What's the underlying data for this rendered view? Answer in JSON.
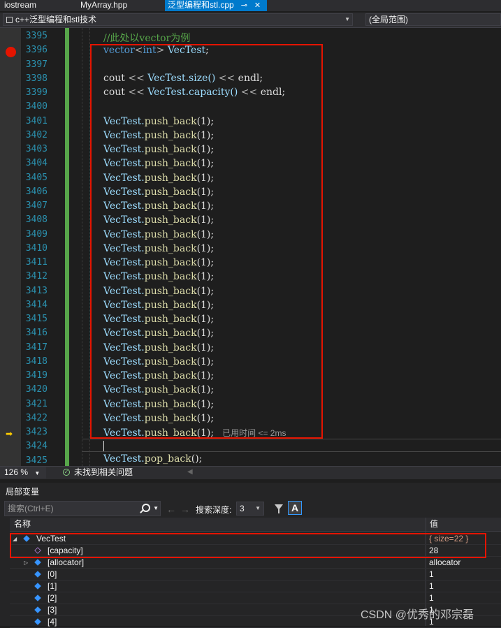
{
  "tabs": [
    {
      "label": "iostream",
      "active": false
    },
    {
      "label": "MyArray.hpp",
      "active": false
    },
    {
      "label": "泛型编程和stl.cpp",
      "active": true
    }
  ],
  "tab_pin_icon": "pin-icon",
  "tab_close_icon": "close-icon",
  "navbar": {
    "project": "c++泛型编程和stl技术",
    "scope": "(全局范围)"
  },
  "editor": {
    "line_numbers": [
      "3395",
      "3396",
      "3397",
      "3398",
      "3399",
      "3400",
      "3401",
      "3402",
      "3403",
      "3404",
      "3405",
      "3406",
      "3407",
      "3408",
      "3409",
      "3410",
      "3411",
      "3412",
      "3413",
      "3414",
      "3415",
      "3416",
      "3417",
      "3418",
      "3419",
      "3420",
      "3421",
      "3422",
      "3423",
      "3424",
      "3425"
    ],
    "comment": "//此处以vector为例",
    "decl_type": "vector",
    "decl_lt": "<",
    "decl_int": "int",
    "decl_gt": ">",
    "decl_var": "VecTest",
    "semicolon": ";",
    "cout": "cout",
    "shift": "<<",
    "size_call": "VecTest.size()",
    "capacity_call": "VecTest.capacity()",
    "endl": "endl",
    "push_back_var": "VecTest.",
    "push_back_fn": "push_back",
    "push_back_arg": "(1);",
    "pop_back_var": "VecTest.",
    "pop_back_fn": "pop_back",
    "pop_back_arg": "();",
    "elapsed": "已用时间 <= 2ms",
    "breakpoint_line": "3396",
    "current_line": "3423"
  },
  "status": {
    "zoom": "126 %",
    "issues": "未找到相关问题"
  },
  "locals": {
    "title": "局部变量",
    "search_placeholder": "搜索(Ctrl+E)",
    "depth_label": "搜索深度:",
    "depth_value": "3",
    "font_button": "A",
    "col_name": "名称",
    "col_value": "值",
    "rows": [
      {
        "name": "VecTest",
        "value": "{ size=22 }",
        "level": 0,
        "expanded": true
      },
      {
        "name": "[capacity]",
        "value": "28",
        "level": 1,
        "expanded": false
      },
      {
        "name": "[allocator]",
        "value": "allocator",
        "level": 1,
        "expanded": false
      },
      {
        "name": "[0]",
        "value": "1",
        "level": 1,
        "expanded": false
      },
      {
        "name": "[1]",
        "value": "1",
        "level": 1,
        "expanded": false
      },
      {
        "name": "[2]",
        "value": "1",
        "level": 1,
        "expanded": false
      },
      {
        "name": "[3]",
        "value": "1",
        "level": 1,
        "expanded": false
      },
      {
        "name": "[4]",
        "value": "1",
        "level": 1,
        "expanded": false
      }
    ]
  },
  "watermark": "CSDN @优秀的邓宗磊",
  "colors": {
    "accent": "#007acc",
    "highlight_box": "#e51400",
    "breakpoint": "#e51400",
    "line_number": "#2b91af",
    "keyword": "#569cd6",
    "variable": "#9cdcfe"
  }
}
